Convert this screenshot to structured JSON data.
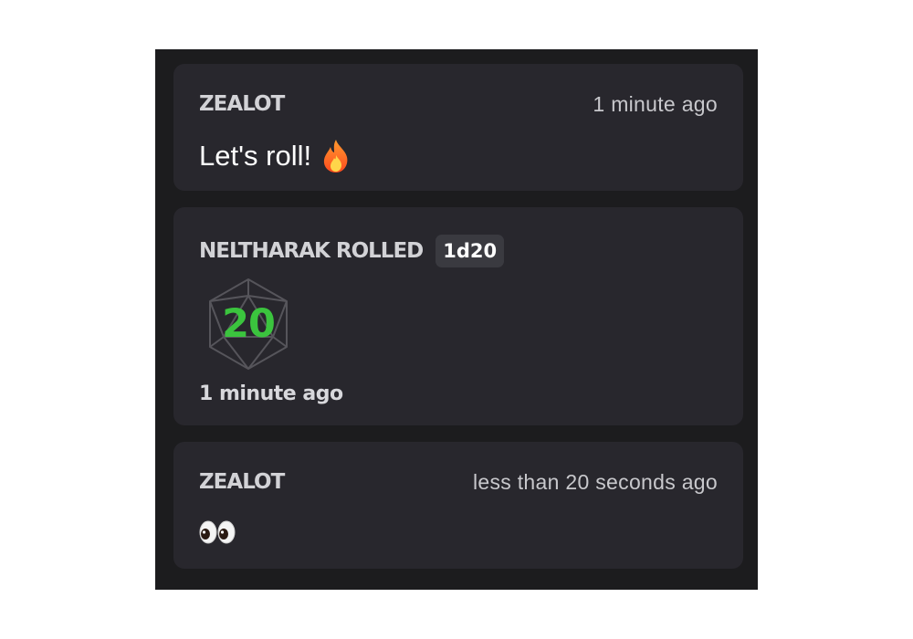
{
  "messages": [
    {
      "author": "ZEALOT",
      "timestamp": "1 minute ago",
      "text": "Let's roll!",
      "emoji": "fire-icon"
    },
    {
      "author": "NELTHARAK ROLLED",
      "dice": "1d20",
      "result": "20",
      "timestamp": "1 minute ago",
      "result_color": "#3bc43e"
    },
    {
      "author": "ZEALOT",
      "timestamp": "less than 20 seconds ago",
      "emoji": "eyes-icon"
    }
  ],
  "colors": {
    "panel_bg": "#1c1c1e",
    "card_bg": "#28272d",
    "badge_bg": "#3a3a40"
  }
}
